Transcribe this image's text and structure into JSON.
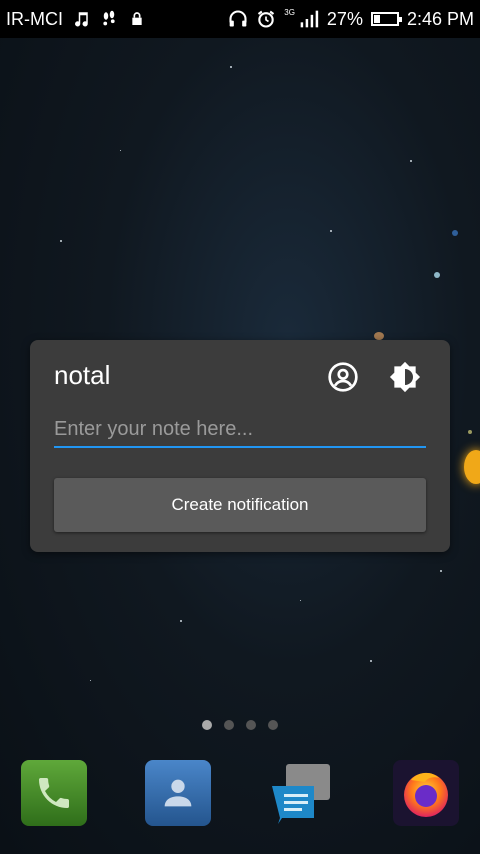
{
  "status_bar": {
    "carrier": "IR-MCI",
    "network_type": "3G",
    "battery_percent": "27%",
    "battery_level": 0.27,
    "time": "2:46 PM"
  },
  "widget": {
    "title": "notal",
    "note_placeholder": "Enter your note here...",
    "create_button_label": "Create notification",
    "icons": [
      "account-circle-icon",
      "brightness-icon"
    ]
  },
  "home": {
    "page_count": 4,
    "active_page": 1,
    "dock_apps": [
      "phone-icon",
      "contacts-icon",
      "messages-icon",
      "firefox-icon"
    ]
  },
  "colors": {
    "accent": "#2196f3",
    "widget_bg": "#3c3c3c",
    "button_bg": "#5a5a5a"
  }
}
